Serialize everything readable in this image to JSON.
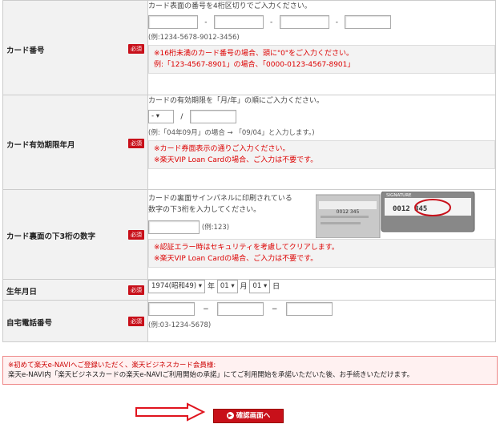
{
  "card_number": {
    "label": "カード番号",
    "required": "必須",
    "hint": "カード表面の番号を4桁区切りでご入力ください。",
    "dash": "-",
    "example": "(例:1234-5678-9012-3456)",
    "warn1": "※16桁未満のカード番号の場合、頭に\"0\"をご入力ください。",
    "warn2": "例:「123-4567-8901」の場合、「0000-0123-4567-8901」"
  },
  "expiry": {
    "label": "カード有効期限年月",
    "required": "必須",
    "hint": "カードの有効期限を「月/年」の順にご入力ください。",
    "month_value": "-",
    "slash": "/",
    "example": "(例:「04年09月」の場合 → 「09/04」と入力します。)",
    "warn1": "※カード券面表示の通りご入力ください。",
    "warn2": "※楽天VIP Loan Cardの場合、ご入力は不要です。"
  },
  "cvv": {
    "label": "カード裏面の下3桁の数字",
    "required": "必須",
    "hint1": "カードの裏面サインパネルに印刷されている",
    "hint2": "数字の下3桁を入力してください。",
    "example": "(例:123)",
    "card_sig": "SIGNATURE",
    "card_num": "0012 345",
    "card_circle": "0012 345",
    "warn1": "※認証エラー時はセキュリティを考慮してクリアします。",
    "warn2": "※楽天VIP Loan Cardの場合、ご入力は不要です。"
  },
  "birth": {
    "label": "生年月日",
    "required": "必須",
    "year_value": "1974(昭和49)",
    "year_unit": "年",
    "month_value": "01",
    "month_unit": "月",
    "day_value": "01",
    "day_unit": "日"
  },
  "phone": {
    "label": "自宅電話番号",
    "required": "必須",
    "dash": "−",
    "example": "(例:03-1234-5678)"
  },
  "notice": {
    "line1": "※初めて楽天e-NAVIへご登録いただく、楽天ビジネスカード会員様:",
    "line2": "楽天e-NAVI内「楽天ビジネスカードの楽天e-NAVIご利用開始の承諾」にてご利用開始を承諾いただいた後、お手続きいただけます。"
  },
  "confirm_button": "確認画面へ",
  "colors": {
    "accent": "#c8101a",
    "warn": "#dd0000",
    "label_bg": "#f2f2f2"
  }
}
